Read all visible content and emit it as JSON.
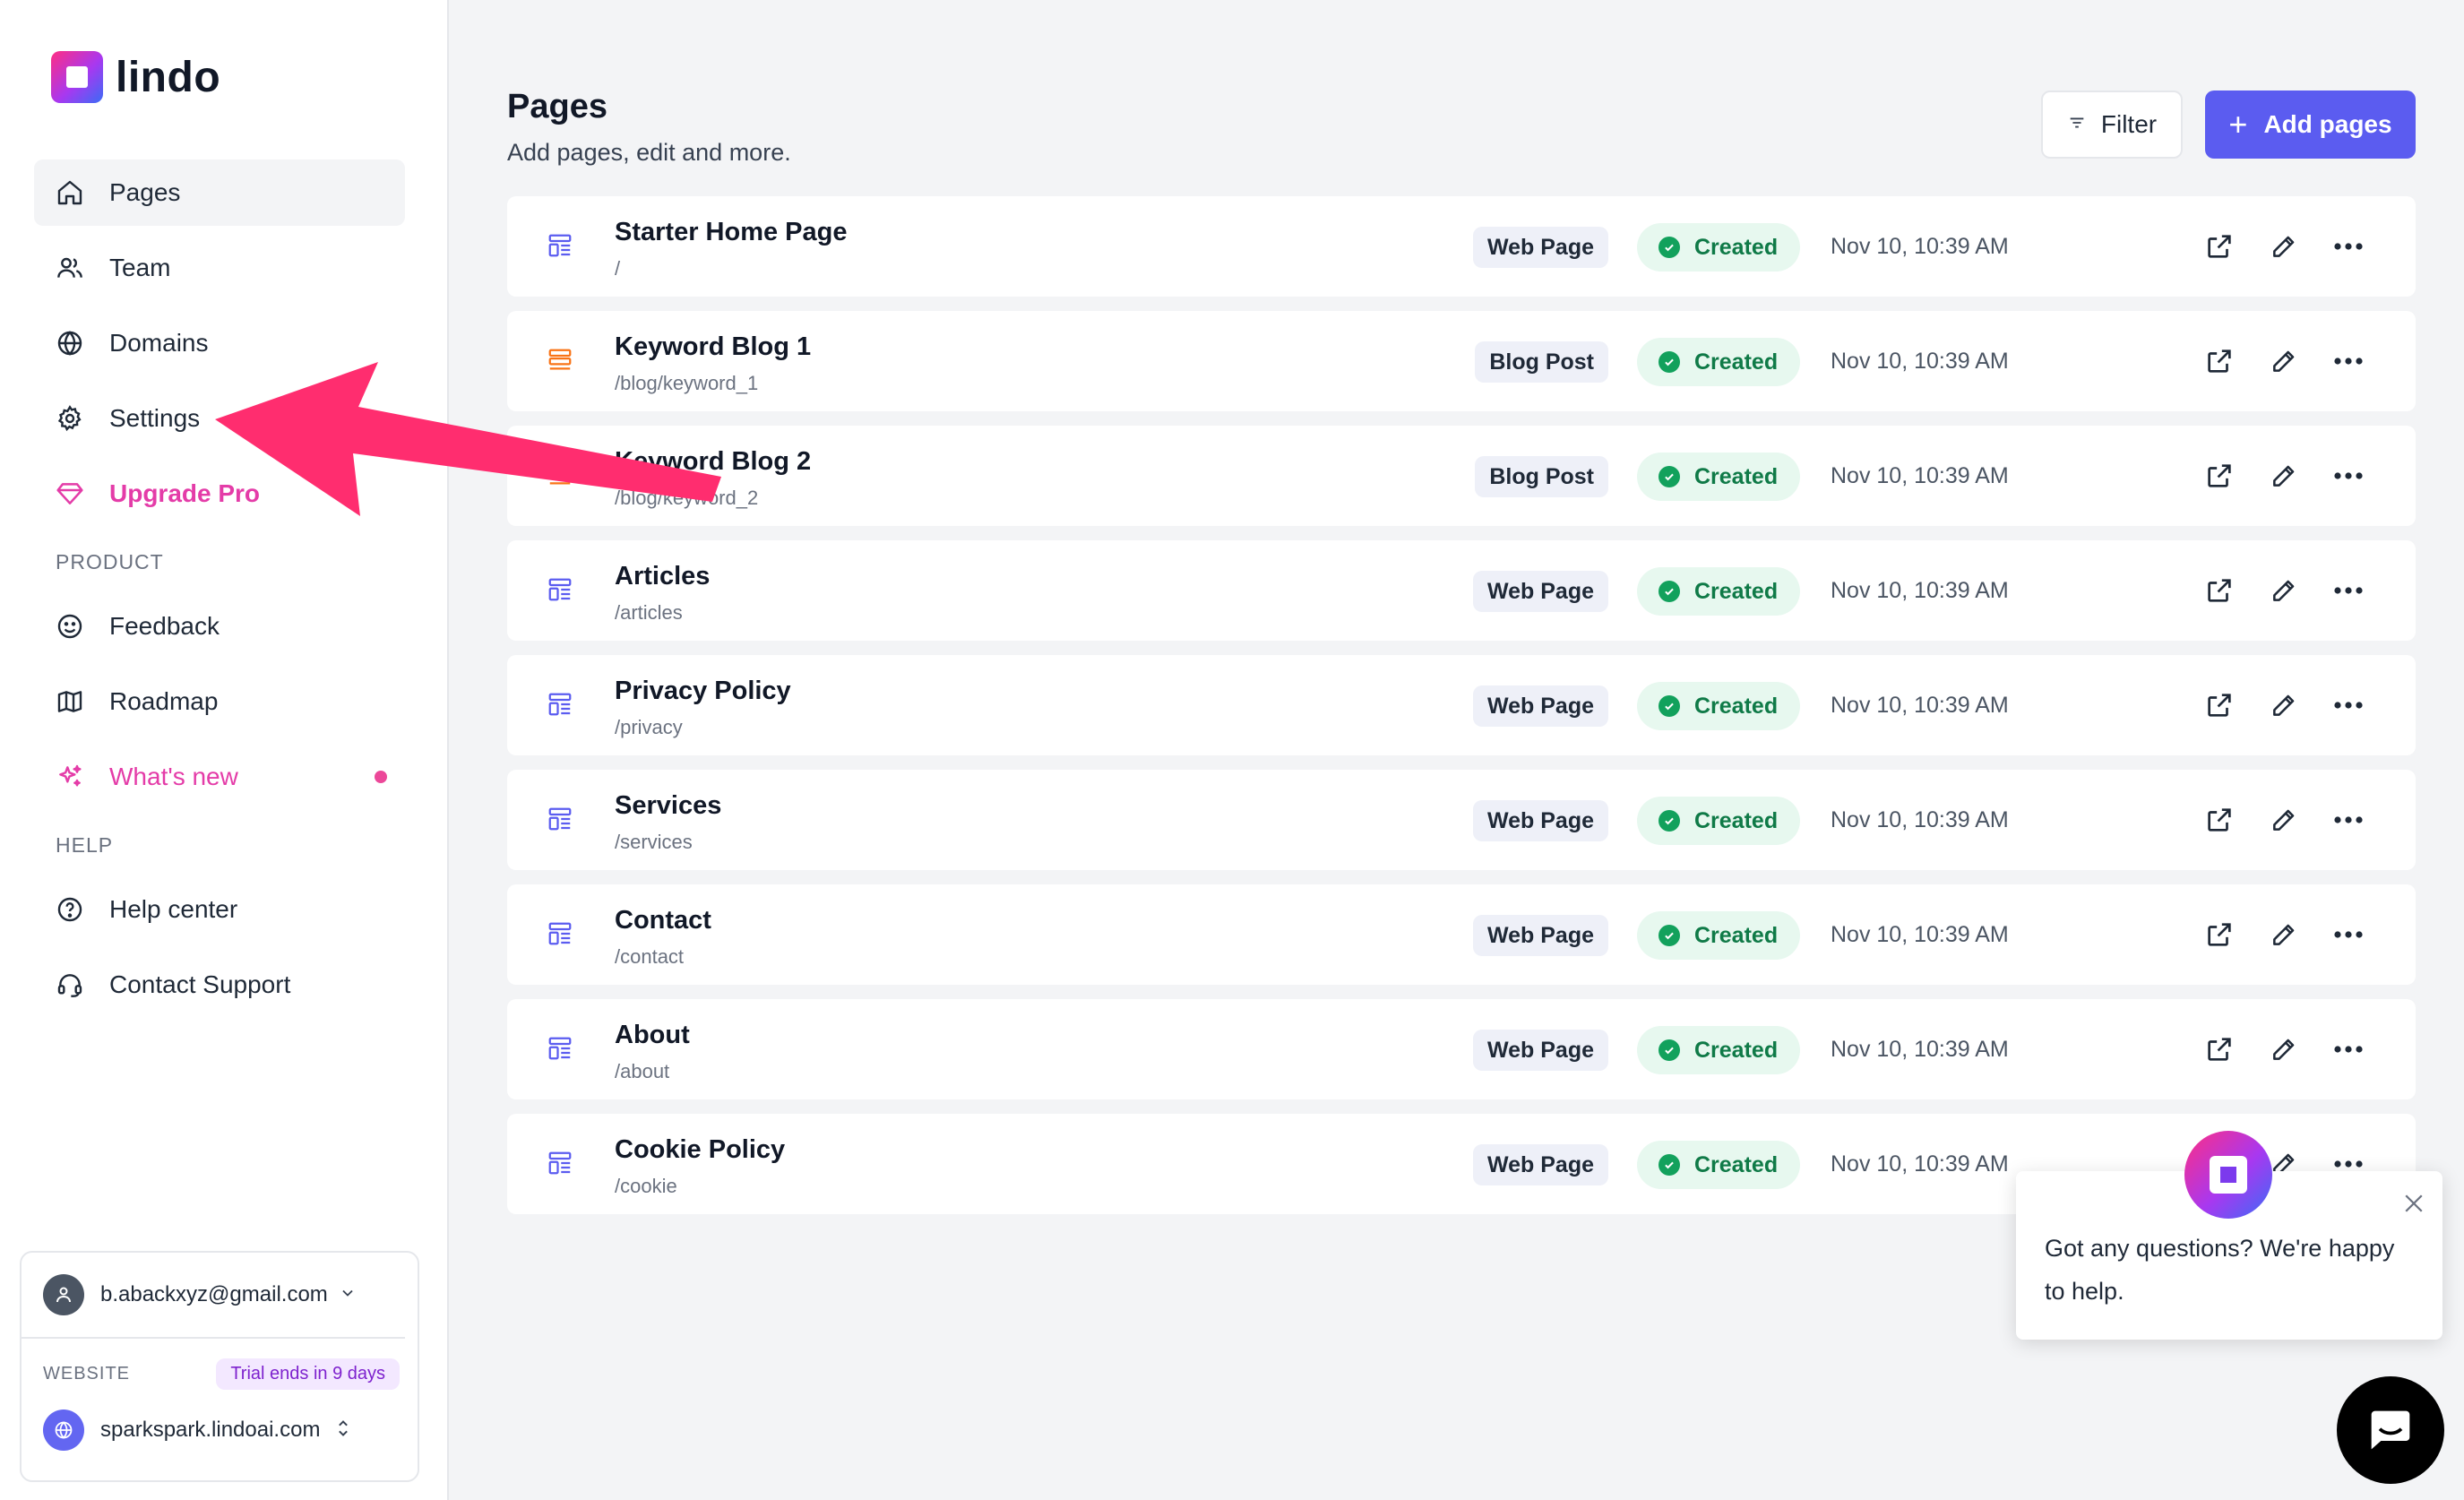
{
  "brand": {
    "name": "lindo"
  },
  "sidebar": {
    "nav": [
      {
        "label": "Pages",
        "icon": "home-icon",
        "active": true
      },
      {
        "label": "Team",
        "icon": "users-icon"
      },
      {
        "label": "Domains",
        "icon": "globe-icon"
      },
      {
        "label": "Settings",
        "icon": "gear-icon"
      },
      {
        "label": "Upgrade Pro",
        "icon": "diamond-icon"
      }
    ],
    "product_heading": "PRODUCT",
    "product": [
      {
        "label": "Feedback",
        "icon": "smile-icon"
      },
      {
        "label": "Roadmap",
        "icon": "map-icon"
      },
      {
        "label": "What's new",
        "icon": "sparkles-icon"
      }
    ],
    "help_heading": "HELP",
    "help": [
      {
        "label": "Help center",
        "icon": "help-circle-icon"
      },
      {
        "label": "Contact Support",
        "icon": "headset-icon"
      }
    ],
    "account": {
      "email": "b.abackxyz@gmail.com",
      "website_label": "WEBSITE",
      "trial": "Trial ends in 9 days",
      "site": "sparkspark.lindoai.com"
    }
  },
  "header": {
    "title": "Pages",
    "subtitle": "Add pages, edit and more.",
    "filter_label": "Filter",
    "add_label": "Add pages"
  },
  "pages": [
    {
      "name": "Starter Home Page",
      "path": "/",
      "type": "Web Page",
      "status": "Created",
      "date": "Nov 10, 10:39 AM"
    },
    {
      "name": "Keyword Blog 1",
      "path": "/blog/keyword_1",
      "type": "Blog Post",
      "status": "Created",
      "date": "Nov 10, 10:39 AM"
    },
    {
      "name": "Keyword Blog 2",
      "path": "/blog/keyword_2",
      "type": "Blog Post",
      "status": "Created",
      "date": "Nov 10, 10:39 AM"
    },
    {
      "name": "Articles",
      "path": "/articles",
      "type": "Web Page",
      "status": "Created",
      "date": "Nov 10, 10:39 AM"
    },
    {
      "name": "Privacy Policy",
      "path": "/privacy",
      "type": "Web Page",
      "status": "Created",
      "date": "Nov 10, 10:39 AM"
    },
    {
      "name": "Services",
      "path": "/services",
      "type": "Web Page",
      "status": "Created",
      "date": "Nov 10, 10:39 AM"
    },
    {
      "name": "Contact",
      "path": "/contact",
      "type": "Web Page",
      "status": "Created",
      "date": "Nov 10, 10:39 AM"
    },
    {
      "name": "About",
      "path": "/about",
      "type": "Web Page",
      "status": "Created",
      "date": "Nov 10, 10:39 AM"
    },
    {
      "name": "Cookie Policy",
      "path": "/cookie",
      "type": "Web Page",
      "status": "Created",
      "date": "Nov 10, 10:39 AM"
    }
  ],
  "chat": {
    "message": "Got any questions? We're happy to help."
  },
  "colors": {
    "accent": "#5b5cf0",
    "pink": "#e43ca8",
    "status_green": "#12a15c",
    "arrow": "#ff2d6f"
  }
}
